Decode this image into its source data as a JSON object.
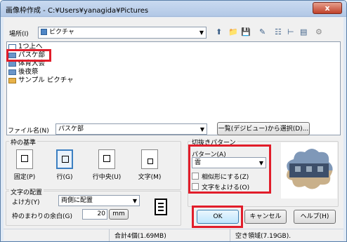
{
  "window": {
    "title": "画像枠作成 - C:¥Users¥yanagida¥Pictures",
    "close": "x"
  },
  "location": {
    "label": "場所(I)",
    "value": "ピクチャ"
  },
  "files": [
    {
      "name": "1つ上へ"
    },
    {
      "name": "パスケ部"
    },
    {
      "name": "体育大会"
    },
    {
      "name": "後夜祭"
    },
    {
      "name": "サンプル ピクチャ"
    }
  ],
  "filename": {
    "label": "ファイル名(N)",
    "value": "パスケ部",
    "browse_button": "一覧(デジビュー)から選択(D)..."
  },
  "frame_basis": {
    "title": "枠の基準",
    "options": [
      {
        "label": "固定(P)"
      },
      {
        "label": "行(G)"
      },
      {
        "label": "行中央(U)"
      },
      {
        "label": "文字(M)"
      }
    ]
  },
  "text_layout": {
    "title": "文字の配置",
    "wrap_label": "よけ方(Y)",
    "wrap_value": "両側に配置",
    "margin_label": "枠のまわりの余白(G)",
    "margin_value": "20",
    "margin_unit": "mm"
  },
  "crop_pattern": {
    "title": "切抜きパターン",
    "pattern_label": "パターン(A)",
    "pattern_value": "雲",
    "similar_label": "相似形にする(Z)",
    "avoid_text_label": "文字をよける(O)"
  },
  "buttons": {
    "ok": "OK",
    "cancel": "キャンセル",
    "help": "ヘルプ(H)"
  },
  "status": {
    "total": "合計4個(1.69MB)",
    "free": "空き領域(7.19GB)."
  },
  "colors": {
    "highlight": "#e11d2a",
    "selected_border": "#3c7fc1"
  }
}
